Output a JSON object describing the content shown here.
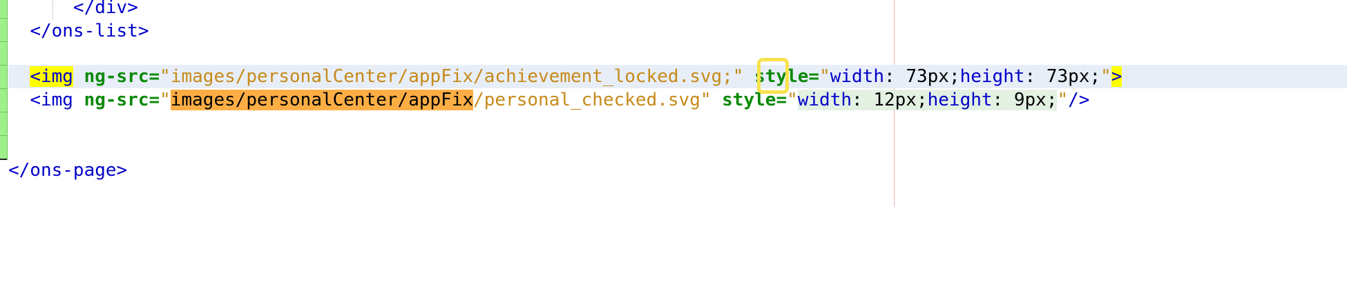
{
  "editor": {
    "lines": [
      {
        "indent": "      ",
        "text": "</div>"
      },
      {
        "indent": "  ",
        "text": "</ons-list>"
      },
      {
        "indent": "",
        "text": ""
      },
      {
        "indent": "  ",
        "open": "<img",
        "attr1": "ng-src",
        "eq1": "=",
        "quote_open": "\"",
        "src_value": "images/personalCenter/appFix/achievement_locked.svg",
        "src_tail": ";\"",
        "attr2": "style",
        "eq2": "=",
        "style_quote_open": "\"",
        "prop1": "width",
        "sep1": ": ",
        "val1": "73px",
        "semi1": ";",
        "prop2": "height",
        "sep2": ": ",
        "val2": "73px",
        "semi2": ";",
        "style_quote_close": "\"",
        "close": ">"
      },
      {
        "indent": "  ",
        "open": "<img",
        "attr1": "ng-src",
        "eq1": "=",
        "quote_open": "\"",
        "src_highlight": "images/personalCenter/appFix",
        "src_rest": "/personal_checked.svg\"",
        "attr2": "style",
        "eq2": "=",
        "style_quote_open": "\"",
        "prop1": "width",
        "sep1": ": ",
        "val1": "12px",
        "semi1": ";",
        "prop2": "height",
        "sep2": ": ",
        "val2": "9px",
        "semi2": ";",
        "style_quote_close": "\"",
        "close": "/>"
      },
      {
        "indent": "",
        "text": ""
      },
      {
        "indent": "",
        "text": ""
      },
      {
        "indent": "",
        "text": "</ons-page>"
      }
    ]
  },
  "colors": {
    "tag": "#0000c8",
    "attribute": "#0a8a0a",
    "string": "#c68a1a",
    "find_highlight": "#fcae45",
    "brace_match": "#ffff00",
    "current_line": "#e8eef7",
    "gutter_changed": "#9ef08a"
  }
}
